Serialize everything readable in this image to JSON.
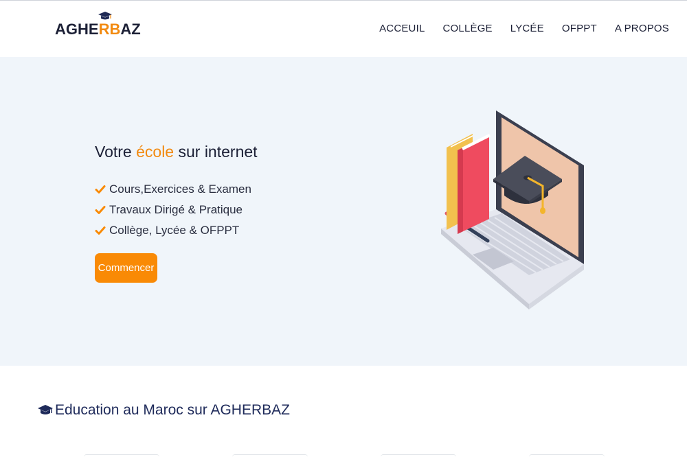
{
  "logo": {
    "part1": "AGHE",
    "part2": "RB",
    "part3": "AZ",
    "alt": "AGHERBAZ"
  },
  "nav": {
    "items": [
      {
        "label": "ACCEUIL"
      },
      {
        "label": "COLLÈGE"
      },
      {
        "label": "LYCÉE"
      },
      {
        "label": "OFPPT"
      },
      {
        "label": "A PROPOS"
      }
    ]
  },
  "hero": {
    "title_before": "Votre ",
    "title_accent": "école",
    "title_after": " sur internet",
    "features": [
      "Cours,Exercices & Examen",
      "Travaux Dirigé & Pratique",
      "Collège, Lycée & OFPPT"
    ],
    "cta_label": "Commencer",
    "illustration_icon": "laptop-books-graduation-cap-illustration"
  },
  "section": {
    "title": "Education au Maroc sur AGHERBAZ",
    "icon": "graduation-cap-icon"
  },
  "colors": {
    "accent": "#f98a05",
    "hero_bg": "#f0f5fa",
    "text_dark": "#1c2036",
    "section_title": "#1e2a5a"
  }
}
